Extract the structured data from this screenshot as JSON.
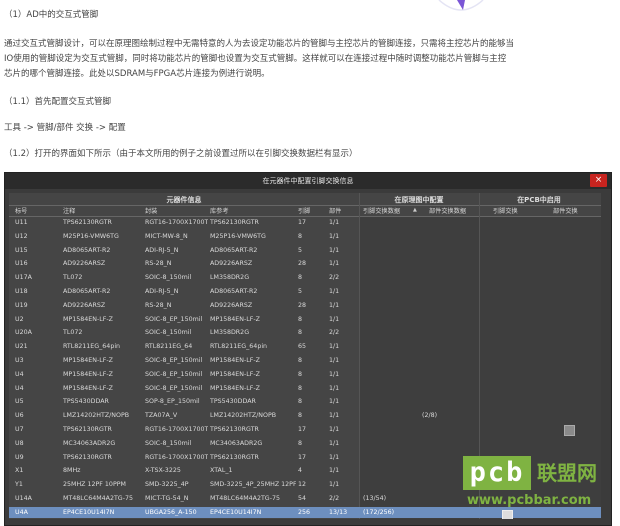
{
  "article": {
    "heading": "（1）AD中的交互式管脚",
    "para1_line1": "通过交互式管脚设计，可以在原理图绘制过程中无需特意的人为去设定功能芯片的管脚与主控芯片的管脚连接，只需将主控芯片的能够当",
    "para1_line2": "IO使用的管脚设定为交互式管脚，同时将功能芯片的管脚也设置为交互式管脚。这样就可以在连接过程中随时调整功能芯片管脚与主控",
    "para1_line3": "芯片的哪个管脚连接。此处以SDRAM与FPGA芯片连接为例进行说明。",
    "sub1": "（1.1）首先配置交互式管脚",
    "path": "工具 -> 管脚/部件 交换 -> 配置",
    "sub2": "（1.2）打开的界面如下所示（由于本文所用的例子之前设置过所以在引脚交换数据栏有显示）"
  },
  "dialog": {
    "title": "在元器件中配置引脚交换信息",
    "close": "×",
    "groups": {
      "info": "元器件信息",
      "schematic": "在原理图中配置",
      "pcb": "在PCB中启用"
    },
    "columns": [
      "标号",
      "注释",
      "封装",
      "库参考",
      "引脚",
      "部件",
      "引脚交换数据",
      "部件交换数据",
      "引脚交换",
      "部件交换"
    ],
    "rows": [
      [
        "U11",
        "TPS62130RGTR",
        "RGT16-1700X1700TP",
        "TPS62130RGTR",
        "17",
        "1/1",
        "",
        ""
      ],
      [
        "U12",
        "M25P16-VMW6TG",
        "MICT-MW-8_N",
        "M25P16-VMW6TG",
        "8",
        "1/1",
        "",
        ""
      ],
      [
        "U15",
        "AD8065ART-R2",
        "ADI-RJ-5_N",
        "AD8065ART-R2",
        "5",
        "1/1",
        "",
        ""
      ],
      [
        "U16",
        "AD9226ARSZ",
        "RS-28_N",
        "AD9226ARSZ",
        "28",
        "1/1",
        "",
        ""
      ],
      [
        "U17A",
        "TL072",
        "SOIC-8_150mil",
        "LM358DR2G",
        "8",
        "2/2",
        "",
        ""
      ],
      [
        "U18",
        "AD8065ART-R2",
        "ADI-RJ-5_N",
        "AD8065ART-R2",
        "5",
        "1/1",
        "",
        ""
      ],
      [
        "U19",
        "AD9226ARSZ",
        "RS-28_N",
        "AD9226ARSZ",
        "28",
        "1/1",
        "",
        ""
      ],
      [
        "U2",
        "MP1584EN-LF-Z",
        "SOIC-8_EP_150mil",
        "MP1584EN-LF-Z",
        "8",
        "1/1",
        "",
        ""
      ],
      [
        "U20A",
        "TL072",
        "SOIC-8_150mil",
        "LM358DR2G",
        "8",
        "2/2",
        "",
        ""
      ],
      [
        "U21",
        "RTL8211EG_64pin",
        "RTL8211EG_64",
        "RTL8211EG_64pin",
        "65",
        "1/1",
        "",
        ""
      ],
      [
        "U3",
        "MP1584EN-LF-Z",
        "SOIC-8_EP_150mil",
        "MP1584EN-LF-Z",
        "8",
        "1/1",
        "",
        ""
      ],
      [
        "U4",
        "MP1584EN-LF-Z",
        "SOIC-8_EP_150mil",
        "MP1584EN-LF-Z",
        "8",
        "1/1",
        "",
        ""
      ],
      [
        "U4",
        "MP1584EN-LF-Z",
        "SOIC-8_EP_150mil",
        "MP1584EN-LF-Z",
        "8",
        "1/1",
        "",
        ""
      ],
      [
        "U5",
        "TPS5430DDAR",
        "SOP-8_EP_150mil",
        "TPS5430DDAR",
        "8",
        "1/1",
        "",
        ""
      ],
      [
        "U6",
        "LMZ14202HTZ/NOPB",
        "TZA07A_V",
        "LMZ14202HTZ/NOPB",
        "8",
        "1/1",
        "",
        "(2/8)"
      ],
      [
        "U7",
        "TPS62130RGTR",
        "RGT16-1700X1700TP",
        "TPS62130RGTR",
        "17",
        "1/1",
        "",
        ""
      ],
      [
        "U8",
        "MC34063ADR2G",
        "SOIC-8_150mil",
        "MC34063ADR2G",
        "8",
        "1/1",
        "",
        ""
      ],
      [
        "U9",
        "TPS62130RGTR",
        "RGT16-1700X1700TP",
        "TPS62130RGTR",
        "17",
        "1/1",
        "",
        ""
      ],
      [
        "X1",
        "8MHz",
        "X-TSX-3225",
        "XTAL_1",
        "4",
        "1/1",
        "",
        ""
      ],
      [
        "Y1",
        "25MHZ 12PF 10PPM",
        "SMD-3225_4P",
        "SMD-3225_4P_25MHZ 12PF",
        "12",
        "1/1",
        "",
        ""
      ],
      [
        "U14A",
        "MT48LC64M4A2TG-75",
        "MICT-TG-54_N",
        "MT48LC64M4A2TG-75",
        "54",
        "2/2",
        "(13/54)",
        ""
      ],
      [
        "U4A",
        "EP4CE10U14I7N",
        "UBGA256_A-150",
        "EP4CE10U14I7N",
        "256",
        "13/13",
        "(172/256)",
        ""
      ]
    ]
  },
  "watermark": {
    "brand": "pcb",
    "cn": "联盟网",
    "url": "www.pcbbar.com"
  },
  "colors": {
    "selected_row": "#6d8fbf",
    "close": "#c8241f",
    "watermark": "#7fb342"
  }
}
